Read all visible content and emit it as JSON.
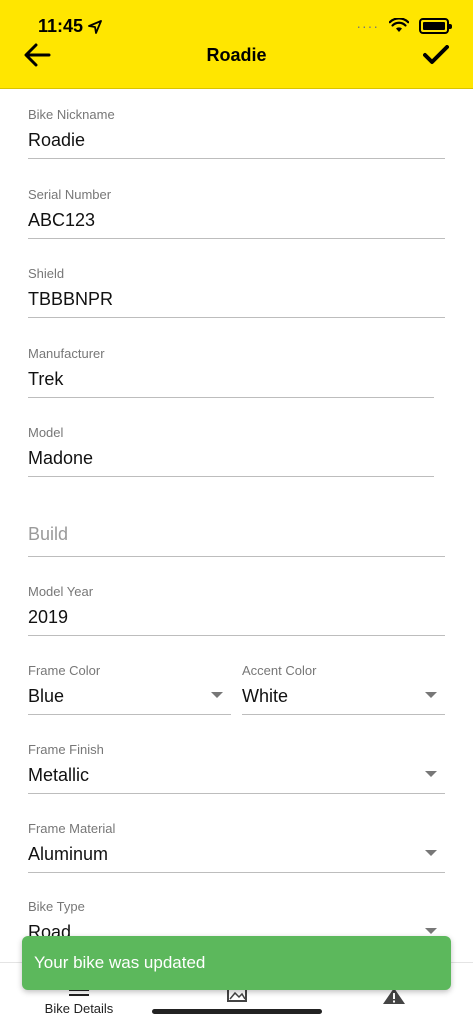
{
  "status_bar": {
    "time": "11:45"
  },
  "header": {
    "title": "Roadie"
  },
  "fields": {
    "nickname": {
      "label": "Bike Nickname",
      "value": "Roadie"
    },
    "serial": {
      "label": "Serial Number",
      "value": "ABC123"
    },
    "shield": {
      "label": "Shield",
      "value": "TBBBNPR"
    },
    "manufacturer": {
      "label": "Manufacturer",
      "value": "Trek"
    },
    "model": {
      "label": "Model",
      "value": "Madone"
    },
    "build": {
      "placeholder": "Build"
    },
    "model_year": {
      "label": "Model Year",
      "value": "2019"
    },
    "frame_color": {
      "label": "Frame Color",
      "value": "Blue"
    },
    "accent_color": {
      "label": "Accent Color",
      "value": "White"
    },
    "frame_finish": {
      "label": "Frame Finish",
      "value": "Metallic"
    },
    "frame_material": {
      "label": "Frame Material",
      "value": "Aluminum"
    },
    "bike_type": {
      "label": "Bike Type",
      "value": "Road"
    }
  },
  "tabs": [
    {
      "label": "Bike Details",
      "icon": "menu-icon"
    },
    {
      "label": "",
      "icon": "photos-icon"
    },
    {
      "label": "",
      "icon": "alert-icon"
    }
  ],
  "toast": {
    "message": "Your bike was updated",
    "color": "#5cb85c"
  },
  "colors": {
    "header": "#ffe600"
  }
}
